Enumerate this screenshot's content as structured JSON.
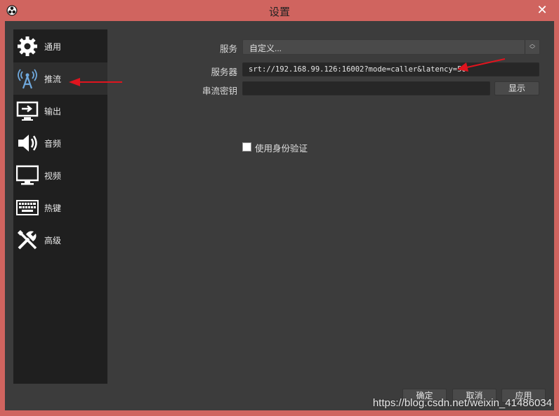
{
  "window": {
    "title": "设置",
    "close_symbol": "✕"
  },
  "sidebar": {
    "items": [
      {
        "label": "通用",
        "icon": "gear-icon"
      },
      {
        "label": "推流",
        "icon": "broadcast-antenna-icon",
        "selected": true
      },
      {
        "label": "输出",
        "icon": "output-monitor-icon"
      },
      {
        "label": "音频",
        "icon": "speaker-icon"
      },
      {
        "label": "视频",
        "icon": "monitor-icon"
      },
      {
        "label": "热键",
        "icon": "keyboard-icon"
      },
      {
        "label": "高级",
        "icon": "tools-icon"
      }
    ]
  },
  "stream": {
    "service_label": "服务",
    "service_value": "自定义...",
    "server_label": "服务器",
    "server_value": "srt://192.168.99.126:16002?mode=caller&latency=50",
    "key_label": "串流密钥",
    "key_value": "",
    "show_button": "显示",
    "auth_checkbox_label": "使用身份验证",
    "auth_checked": false
  },
  "footer": {
    "ok": "确定",
    "cancel": "取消",
    "apply": "应用"
  },
  "watermark": "https://blog.csdn.net/weixin_41486034",
  "colors": {
    "frame": "#d0645f",
    "panel": "#3c3c3c",
    "sidebar": "#1f1f1f",
    "annotation_arrow": "#e0141e"
  }
}
